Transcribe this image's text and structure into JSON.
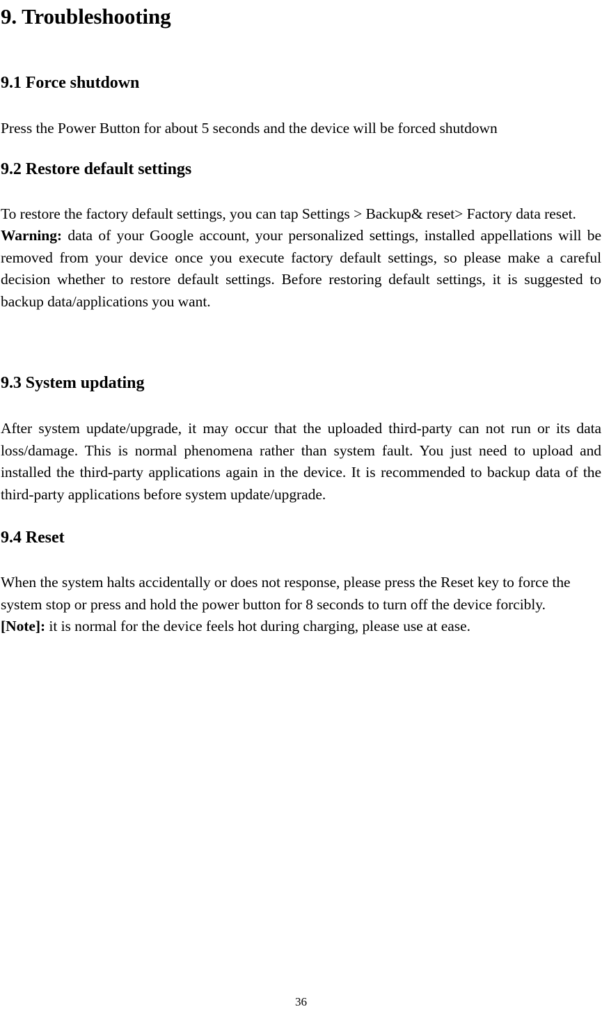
{
  "document": {
    "chapter_title": "9. Troubleshooting",
    "page_number": "36"
  },
  "sections": [
    {
      "heading": "9.1 Force shutdown",
      "paragraphs": [
        "Press the Power Button for about 5 seconds and the device will be forced shutdown"
      ]
    },
    {
      "heading": "9.2 Restore default settings",
      "paragraphs": [
        "To restore the factory default settings, you can tap Settings > Backup& reset> Factory data reset."
      ],
      "warning_label": "Warning:",
      "warning_text": " data of your Google account, your personalized settings, installed appellations will be removed from your device once you execute factory default settings, so please make a careful decision whether to restore default settings. Before restoring default settings, it is suggested to backup data/applications you want."
    },
    {
      "heading": "9.3 System updating",
      "paragraphs": [
        "After system update/upgrade, it may occur that the uploaded third-party can not run or its data loss/damage. This is normal phenomena rather than system fault. You just need to upload and installed the third-party applications again in the device. It is recommended to backup data of the third-party applications before system update/upgrade."
      ]
    },
    {
      "heading": "9.4 Reset",
      "paragraphs": [
        "When the system halts accidentally or does not response, please press the Reset key to force the system stop or press and hold the power button for 8 seconds to turn off the device forcibly."
      ],
      "note_label": "[Note]:",
      "note_text": " it is normal for the device feels hot during charging, please use at ease."
    }
  ]
}
